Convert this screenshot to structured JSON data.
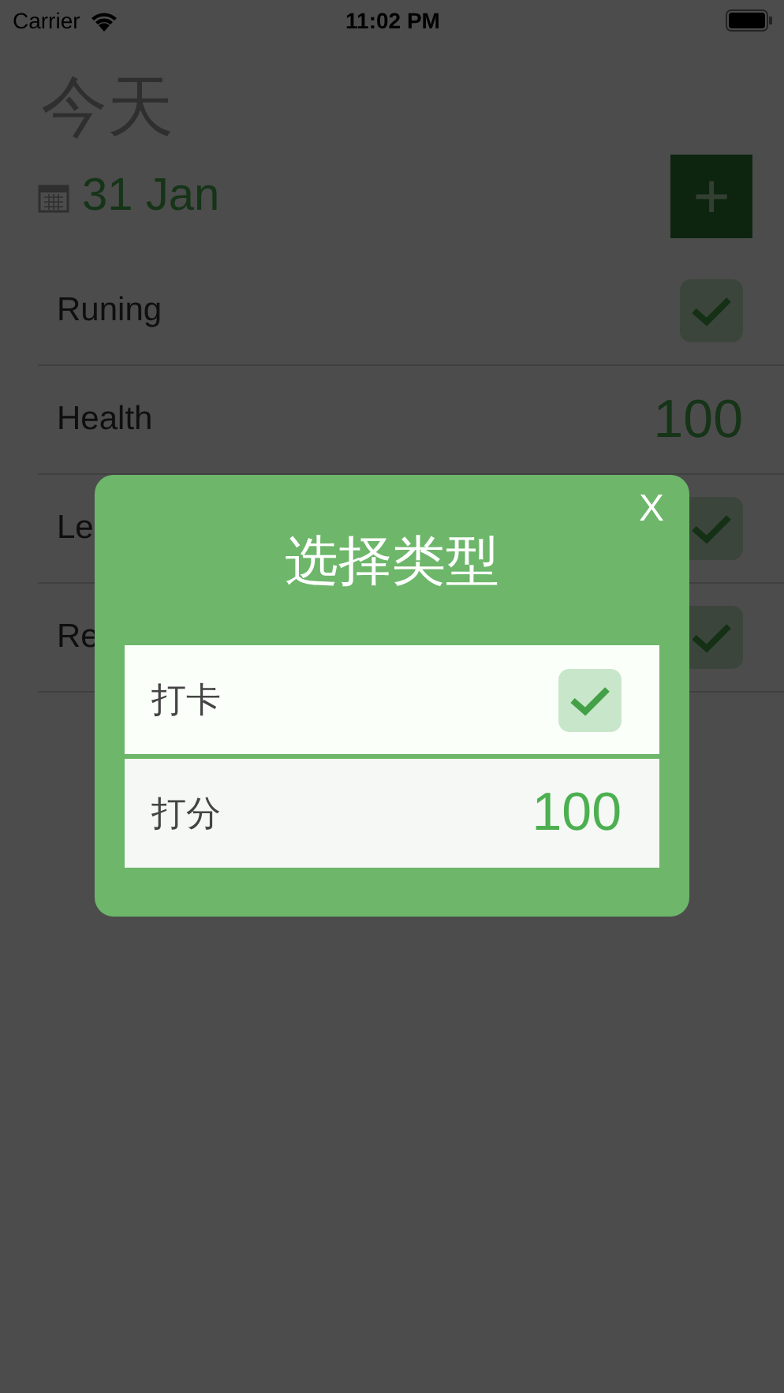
{
  "status_bar": {
    "carrier": "Carrier",
    "time": "11:02 PM"
  },
  "header": {
    "title": "今天",
    "date": "31 Jan",
    "add_button": "+"
  },
  "tasks": [
    {
      "name": "Runing",
      "kind": "check",
      "checked": true
    },
    {
      "name": "Health",
      "kind": "score",
      "value": "100"
    },
    {
      "name": "Le",
      "kind": "check",
      "checked": true
    },
    {
      "name": "Re",
      "kind": "check",
      "checked": true
    }
  ],
  "dialog": {
    "title": "选择类型",
    "close": "X",
    "options": [
      {
        "label": "打卡",
        "kind": "check",
        "checked": true
      },
      {
        "label": "打分",
        "kind": "score",
        "value": "100"
      }
    ]
  }
}
